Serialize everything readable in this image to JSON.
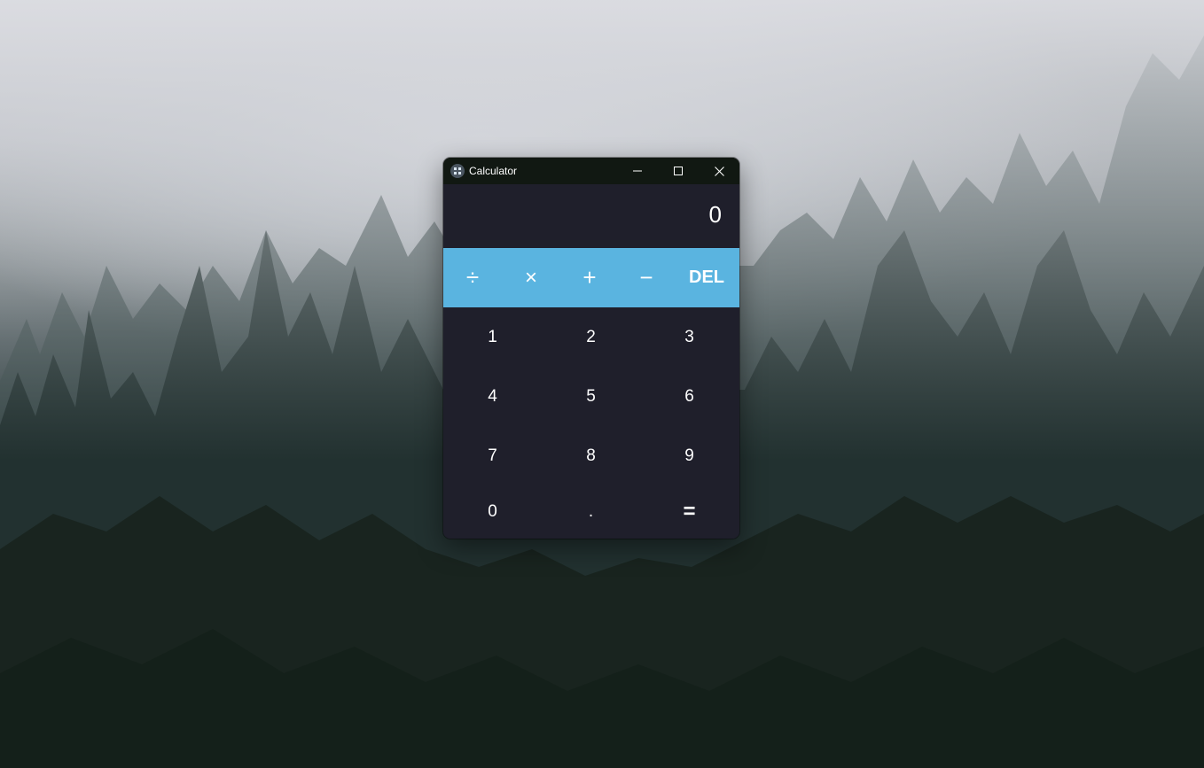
{
  "window": {
    "title": "Calculator",
    "icon": "calculator-app-icon"
  },
  "display": {
    "value": "0"
  },
  "operators": {
    "divide": "÷",
    "multiply": "×",
    "add": "+",
    "subtract": "−",
    "delete": "DEL"
  },
  "keys": {
    "k1": "1",
    "k2": "2",
    "k3": "3",
    "k4": "4",
    "k5": "5",
    "k6": "6",
    "k7": "7",
    "k8": "8",
    "k9": "9",
    "k0": "0",
    "dot": ".",
    "equals": "="
  },
  "colors": {
    "titlebar": "#111812",
    "body": "#1f1f2b",
    "accent": "#5ab4e0",
    "text": "#ffffff"
  },
  "icons": {
    "minimize": "minimize-icon",
    "maximize": "maximize-icon",
    "close": "close-icon"
  }
}
